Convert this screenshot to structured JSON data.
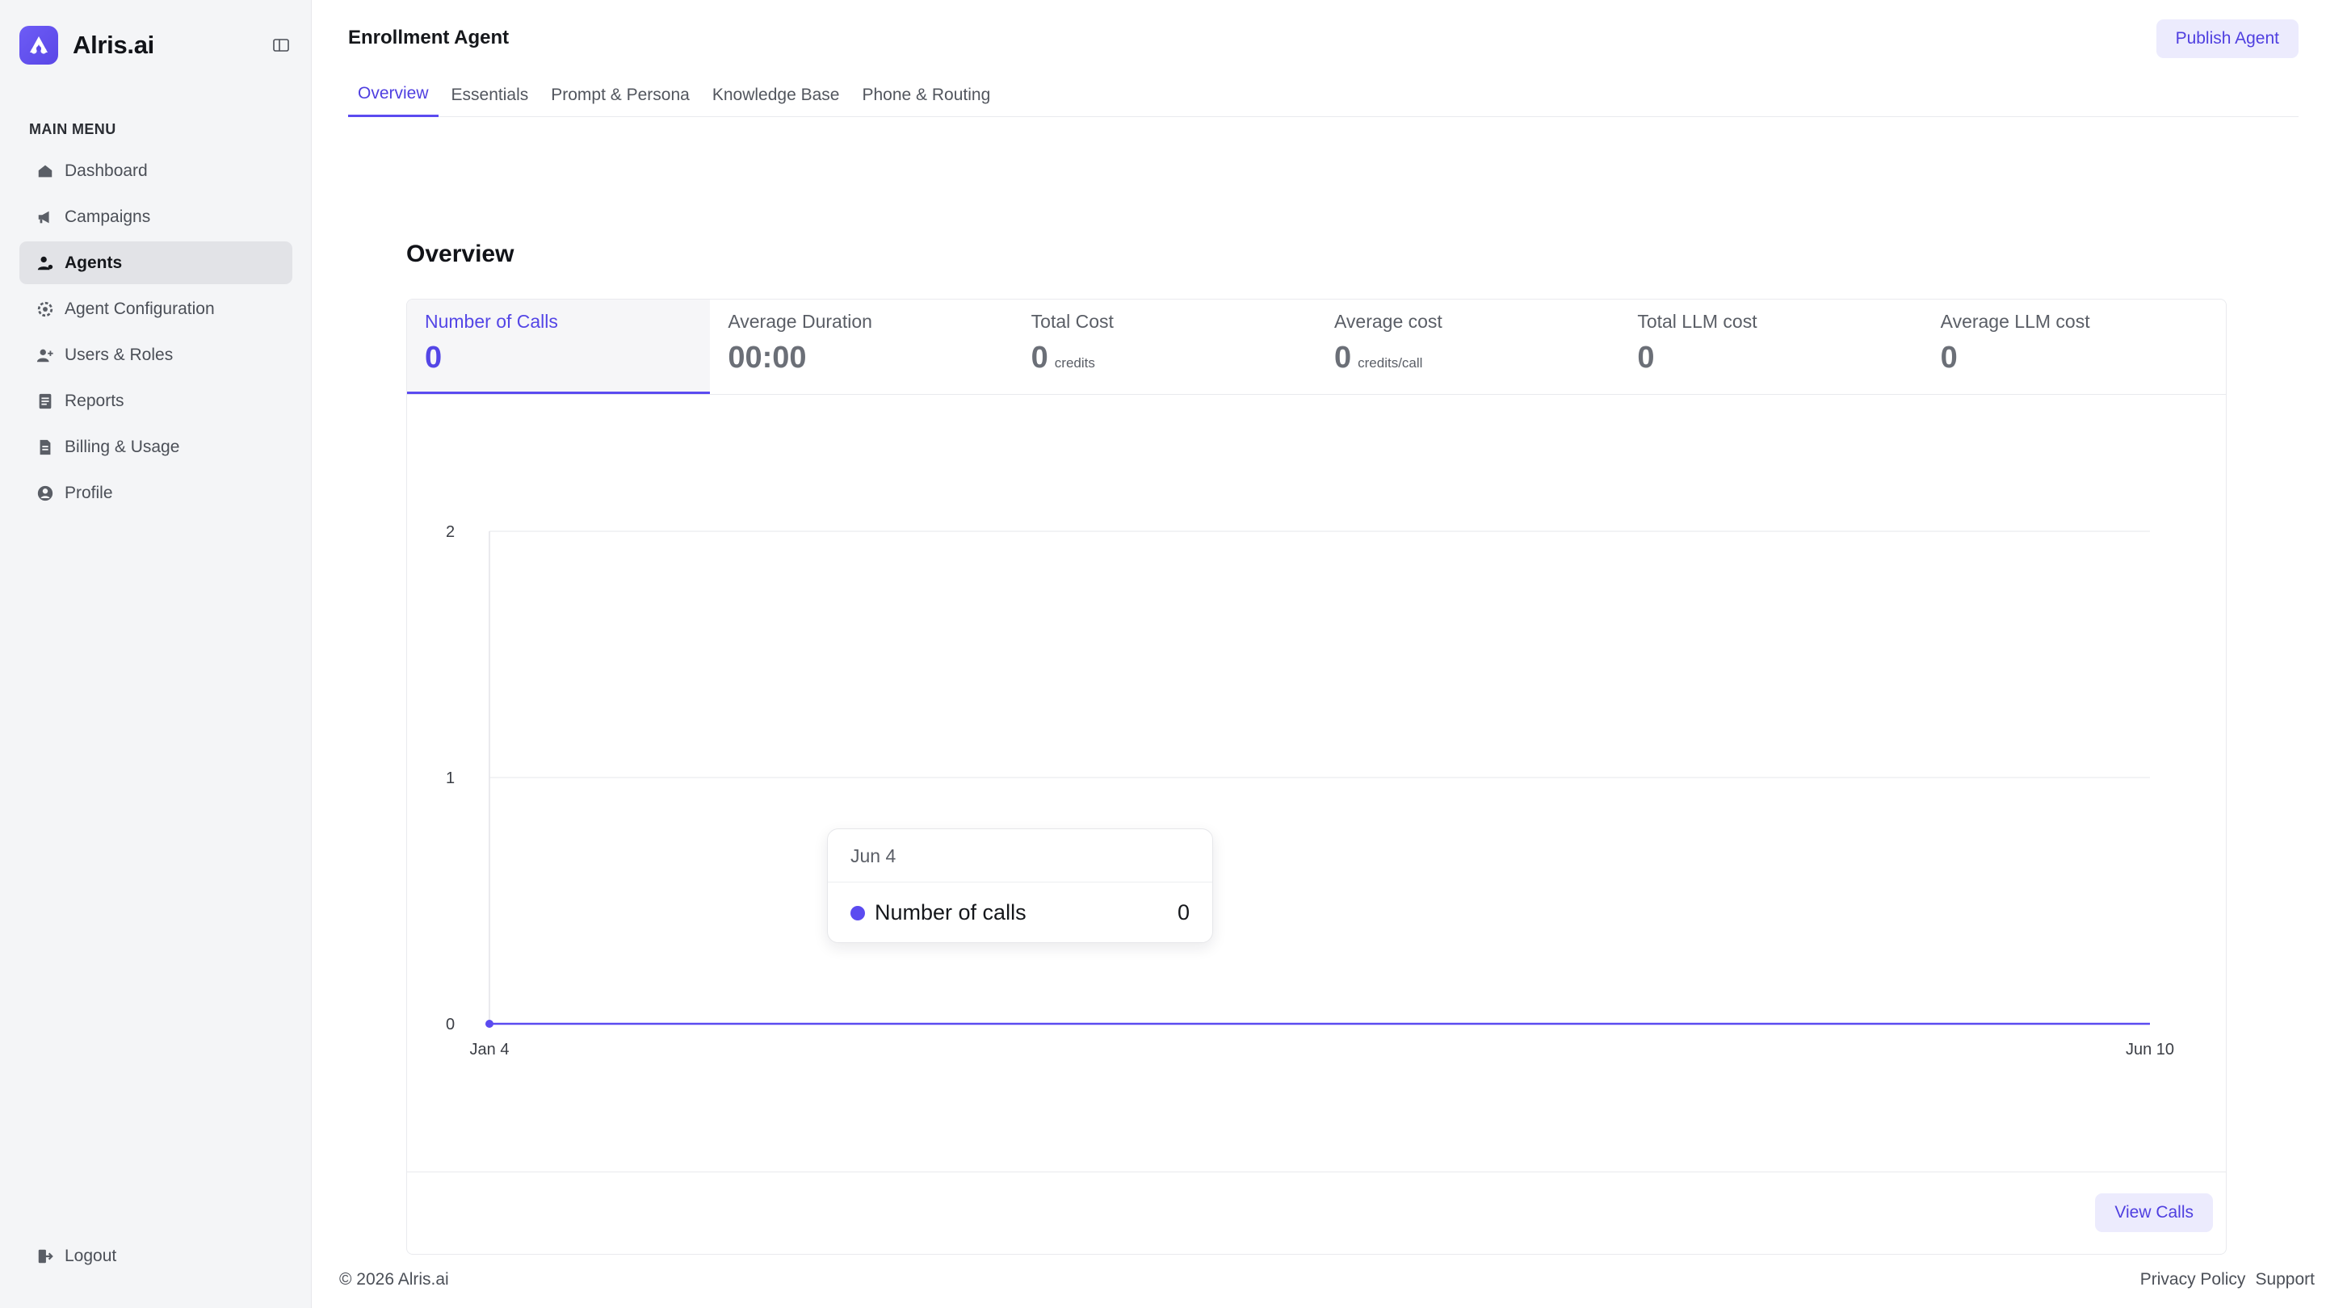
{
  "brand": {
    "name": "Alris.ai",
    "logo_icon": "alris-logo-icon",
    "accent": "#5b4bf0"
  },
  "sidebar": {
    "heading": "MAIN MENU",
    "items": [
      {
        "label": "Dashboard",
        "icon": "home-icon"
      },
      {
        "label": "Campaigns",
        "icon": "megaphone-icon"
      },
      {
        "label": "Agents",
        "icon": "agent-icon",
        "active": true
      },
      {
        "label": "Agent Configuration",
        "icon": "gear-icon"
      },
      {
        "label": "Users & Roles",
        "icon": "users-icon"
      },
      {
        "label": "Reports",
        "icon": "report-icon"
      },
      {
        "label": "Billing & Usage",
        "icon": "billing-icon"
      },
      {
        "label": "Profile",
        "icon": "profile-icon"
      }
    ],
    "logout": "Logout"
  },
  "header": {
    "title": "Enrollment Agent",
    "publish_label": "Publish Agent",
    "tabs": [
      "Overview",
      "Essentials",
      "Prompt & Persona",
      "Knowledge Base",
      "Phone & Routing"
    ],
    "active_tab": "Overview"
  },
  "overview": {
    "title": "Overview",
    "metrics": [
      {
        "label": "Number of Calls",
        "value": "0",
        "unit": "",
        "active": true
      },
      {
        "label": "Average Duration",
        "value": "00:00",
        "unit": ""
      },
      {
        "label": "Total Cost",
        "value": "0",
        "unit": "credits"
      },
      {
        "label": "Average cost",
        "value": "0",
        "unit": "credits/call"
      },
      {
        "label": "Total LLM cost",
        "value": "0",
        "unit": ""
      },
      {
        "label": "Average LLM cost",
        "value": "0",
        "unit": ""
      }
    ],
    "view_calls_label": "View Calls"
  },
  "chart_data": {
    "type": "line",
    "x_start": "Jan 4",
    "x_end": "Jun 10",
    "x_tick_labels": [
      "Jan 4",
      "Jun 10"
    ],
    "y_ticks": [
      0,
      1,
      2
    ],
    "ylim": [
      0,
      2
    ],
    "series": [
      {
        "name": "Number of calls",
        "color": "#5b4bf0",
        "points": [
          {
            "x": "Jan 4",
            "y": 0
          },
          {
            "x": "Jun 10",
            "y": 0
          }
        ]
      }
    ],
    "grid": true,
    "tooltip": {
      "date": "Jun 4",
      "series": "Number of calls",
      "value": "0"
    }
  },
  "footer": {
    "copyright": "© 2026 Alris.ai",
    "links": [
      "Privacy Policy",
      "Support"
    ]
  }
}
